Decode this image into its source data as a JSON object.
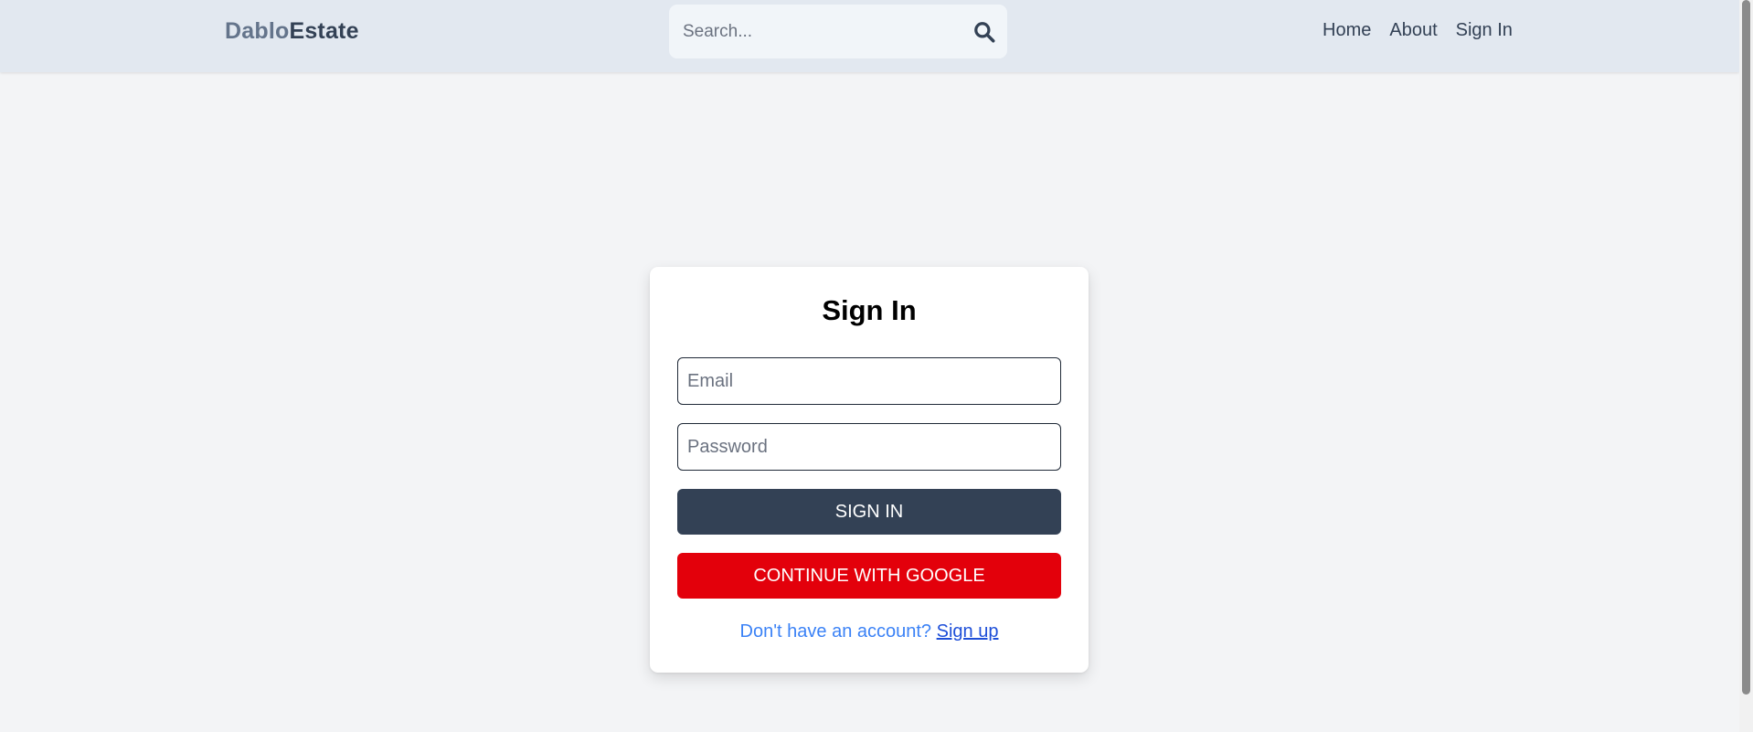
{
  "header": {
    "logo_part1": "Dablo",
    "logo_part2": "Estate",
    "search": {
      "placeholder": "Search...",
      "value": "",
      "icon": "search-icon"
    },
    "nav": [
      {
        "label": "Home"
      },
      {
        "label": "About"
      },
      {
        "label": "Sign In"
      }
    ]
  },
  "signin_form": {
    "title": "Sign In",
    "email_placeholder": "Email",
    "email_value": "",
    "password_placeholder": "Password",
    "password_value": "",
    "submit_label": "SIGN IN",
    "google_label": "CONTINUE WITH GOOGLE",
    "footer_prompt": "Don't have an account?",
    "signup_link": "Sign up"
  },
  "colors": {
    "header_bg": "#e2e8f0",
    "page_bg": "#f3f4f6",
    "primary_button": "#334155",
    "google_button": "#e3000b",
    "link_text": "#3b82f6"
  }
}
